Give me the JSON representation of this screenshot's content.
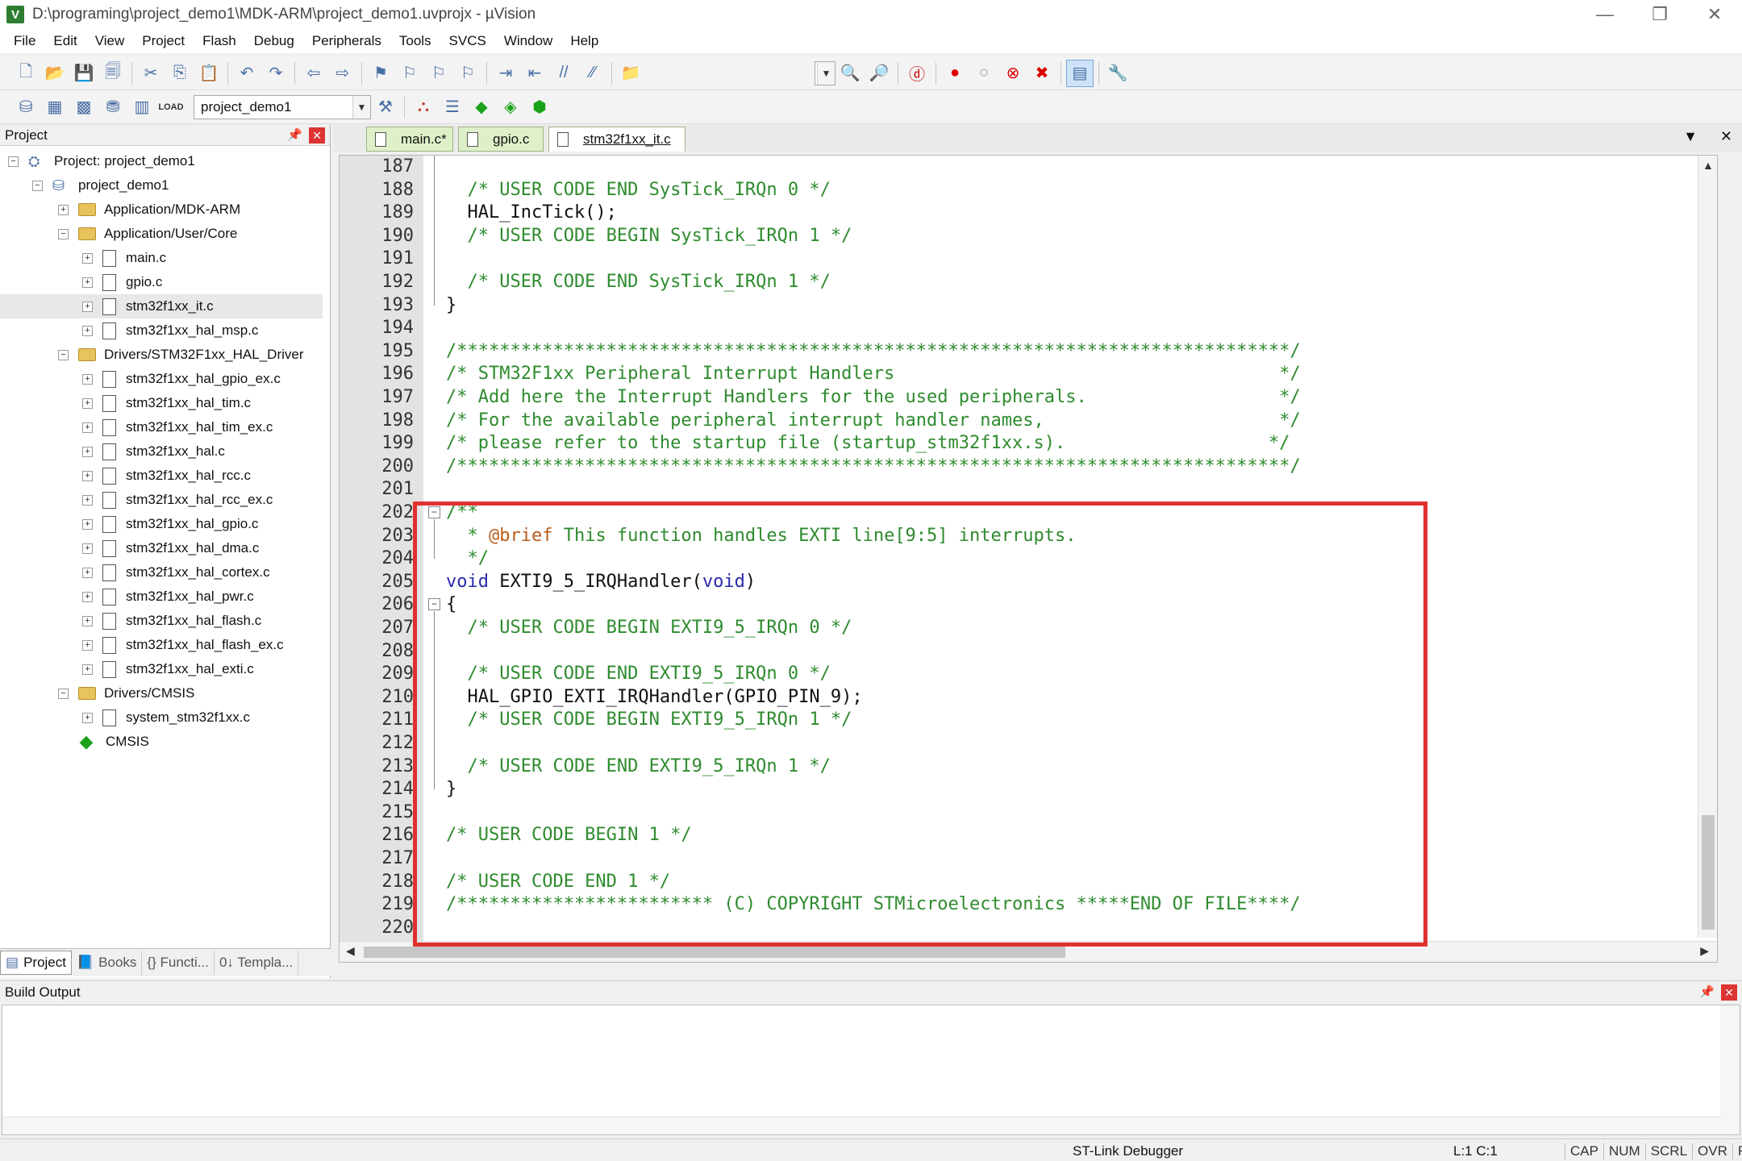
{
  "window": {
    "title": "D:\\programing\\project_demo1\\MDK-ARM\\project_demo1.uvprojx - µVision",
    "app_icon": "V",
    "controls": {
      "minimize": "—",
      "restore": "❐",
      "close": "✕"
    }
  },
  "menu": [
    "File",
    "Edit",
    "View",
    "Project",
    "Flash",
    "Debug",
    "Peripherals",
    "Tools",
    "SVCS",
    "Window",
    "Help"
  ],
  "toolbar": {
    "target_combo": "project_demo1",
    "load_label": "LOAD"
  },
  "project_panel": {
    "title": "Project",
    "tree": [
      {
        "label": "Project: project_demo1",
        "kind": "project",
        "expander": "−",
        "indent": 0
      },
      {
        "label": "project_demo1",
        "kind": "target",
        "expander": "−",
        "indent": 1
      },
      {
        "label": "Application/MDK-ARM",
        "kind": "folder",
        "expander": "+",
        "indent": 2
      },
      {
        "label": "Application/User/Core",
        "kind": "folder",
        "expander": "−",
        "indent": 2
      },
      {
        "label": "main.c",
        "kind": "file",
        "expander": "+",
        "indent": 3
      },
      {
        "label": "gpio.c",
        "kind": "file",
        "expander": "+",
        "indent": 3
      },
      {
        "label": "stm32f1xx_it.c",
        "kind": "file",
        "expander": "+",
        "indent": 3,
        "selected": true
      },
      {
        "label": "stm32f1xx_hal_msp.c",
        "kind": "file",
        "expander": "+",
        "indent": 3
      },
      {
        "label": "Drivers/STM32F1xx_HAL_Driver",
        "kind": "folder",
        "expander": "−",
        "indent": 2
      },
      {
        "label": "stm32f1xx_hal_gpio_ex.c",
        "kind": "file",
        "expander": "+",
        "indent": 3
      },
      {
        "label": "stm32f1xx_hal_tim.c",
        "kind": "file",
        "expander": "+",
        "indent": 3
      },
      {
        "label": "stm32f1xx_hal_tim_ex.c",
        "kind": "file",
        "expander": "+",
        "indent": 3
      },
      {
        "label": "stm32f1xx_hal.c",
        "kind": "file",
        "expander": "+",
        "indent": 3
      },
      {
        "label": "stm32f1xx_hal_rcc.c",
        "kind": "file",
        "expander": "+",
        "indent": 3
      },
      {
        "label": "stm32f1xx_hal_rcc_ex.c",
        "kind": "file",
        "expander": "+",
        "indent": 3
      },
      {
        "label": "stm32f1xx_hal_gpio.c",
        "kind": "file",
        "expander": "+",
        "indent": 3
      },
      {
        "label": "stm32f1xx_hal_dma.c",
        "kind": "file",
        "expander": "+",
        "indent": 3
      },
      {
        "label": "stm32f1xx_hal_cortex.c",
        "kind": "file",
        "expander": "+",
        "indent": 3
      },
      {
        "label": "stm32f1xx_hal_pwr.c",
        "kind": "file",
        "expander": "+",
        "indent": 3
      },
      {
        "label": "stm32f1xx_hal_flash.c",
        "kind": "file",
        "expander": "+",
        "indent": 3
      },
      {
        "label": "stm32f1xx_hal_flash_ex.c",
        "kind": "file",
        "expander": "+",
        "indent": 3
      },
      {
        "label": "stm32f1xx_hal_exti.c",
        "kind": "file",
        "expander": "+",
        "indent": 3
      },
      {
        "label": "Drivers/CMSIS",
        "kind": "folder",
        "expander": "−",
        "indent": 2
      },
      {
        "label": "system_stm32f1xx.c",
        "kind": "file",
        "expander": "+",
        "indent": 3
      },
      {
        "label": "CMSIS",
        "kind": "cmsis",
        "expander": "",
        "indent": 2
      }
    ],
    "tabs": [
      "Project",
      "Books",
      "{} Functi...",
      "0↓ Templa..."
    ]
  },
  "editor": {
    "tabs": [
      {
        "label": "main.c*",
        "active": false
      },
      {
        "label": "gpio.c",
        "active": false
      },
      {
        "label": "stm32f1xx_it.c",
        "active": true
      }
    ],
    "lines": [
      {
        "n": "187",
        "parts": []
      },
      {
        "n": "188",
        "parts": [
          {
            "t": "  /* USER CODE END SysTick_IRQn 0 */",
            "c": "c-comment"
          }
        ]
      },
      {
        "n": "189",
        "parts": [
          {
            "t": "  HAL_IncTick();",
            "c": "c-text"
          }
        ]
      },
      {
        "n": "190",
        "parts": [
          {
            "t": "  /* USER CODE BEGIN SysTick_IRQn 1 */",
            "c": "c-comment"
          }
        ]
      },
      {
        "n": "191",
        "parts": []
      },
      {
        "n": "192",
        "parts": [
          {
            "t": "  /* USER CODE END SysTick_IRQn 1 */",
            "c": "c-comment"
          }
        ]
      },
      {
        "n": "193",
        "parts": [
          {
            "t": "}",
            "c": "c-text"
          }
        ]
      },
      {
        "n": "194",
        "parts": []
      },
      {
        "n": "195",
        "parts": [
          {
            "t": "/******************************************************************************/",
            "c": "c-comment"
          }
        ]
      },
      {
        "n": "196",
        "parts": [
          {
            "t": "/* STM32F1xx Peripheral Interrupt Handlers                                    */",
            "c": "c-comment"
          }
        ]
      },
      {
        "n": "197",
        "parts": [
          {
            "t": "/* Add here the Interrupt Handlers for the used peripherals.                  */",
            "c": "c-comment"
          }
        ]
      },
      {
        "n": "198",
        "parts": [
          {
            "t": "/* For the available peripheral interrupt handler names,                      */",
            "c": "c-comment"
          }
        ]
      },
      {
        "n": "199",
        "parts": [
          {
            "t": "/* please refer to the startup file (startup_stm32f1xx.s).                   */",
            "c": "c-comment"
          }
        ]
      },
      {
        "n": "200",
        "parts": [
          {
            "t": "/******************************************************************************/",
            "c": "c-comment"
          }
        ]
      },
      {
        "n": "201",
        "parts": []
      },
      {
        "n": "202",
        "parts": [
          {
            "t": "/**",
            "c": "c-comment"
          }
        ]
      },
      {
        "n": "203",
        "parts": [
          {
            "t": "  * ",
            "c": "c-comment"
          },
          {
            "t": "@brief",
            "c": "c-doc"
          },
          {
            "t": " This function handles EXTI line[9:5] interrupts.",
            "c": "c-comment"
          }
        ]
      },
      {
        "n": "204",
        "parts": [
          {
            "t": "  */",
            "c": "c-comment"
          }
        ]
      },
      {
        "n": "205",
        "parts": [
          {
            "t": "void",
            "c": "c-kw"
          },
          {
            "t": " EXTI9_5_IRQHandler(",
            "c": "c-text"
          },
          {
            "t": "void",
            "c": "c-kw"
          },
          {
            "t": ")",
            "c": "c-text"
          }
        ]
      },
      {
        "n": "206",
        "parts": [
          {
            "t": "{",
            "c": "c-text"
          }
        ]
      },
      {
        "n": "207",
        "parts": [
          {
            "t": "  /* USER CODE BEGIN EXTI9_5_IRQn 0 */",
            "c": "c-comment"
          }
        ]
      },
      {
        "n": "208",
        "parts": []
      },
      {
        "n": "209",
        "parts": [
          {
            "t": "  /* USER CODE END EXTI9_5_IRQn 0 */",
            "c": "c-comment"
          }
        ]
      },
      {
        "n": "210",
        "parts": [
          {
            "t": "  HAL_GPIO_EXTI_IRQHandler(GPIO_PIN_9);",
            "c": "c-text"
          }
        ]
      },
      {
        "n": "211",
        "parts": [
          {
            "t": "  /* USER CODE BEGIN EXTI9_5_IRQn 1 */",
            "c": "c-comment"
          }
        ]
      },
      {
        "n": "212",
        "parts": []
      },
      {
        "n": "213",
        "parts": [
          {
            "t": "  /* USER CODE END EXTI9_5_IRQn 1 */",
            "c": "c-comment"
          }
        ]
      },
      {
        "n": "214",
        "parts": [
          {
            "t": "}",
            "c": "c-text"
          }
        ]
      },
      {
        "n": "215",
        "parts": []
      },
      {
        "n": "216",
        "parts": [
          {
            "t": "/* USER CODE BEGIN 1 */",
            "c": "c-comment"
          }
        ]
      },
      {
        "n": "217",
        "parts": []
      },
      {
        "n": "218",
        "parts": [
          {
            "t": "/* USER CODE END 1 */",
            "c": "c-comment"
          }
        ]
      },
      {
        "n": "219",
        "parts": [
          {
            "t": "/************************ (C) COPYRIGHT STMicroelectronics *****END OF FILE****/",
            "c": "c-comment"
          }
        ]
      },
      {
        "n": "220",
        "parts": []
      }
    ]
  },
  "build_output": {
    "title": "Build Output"
  },
  "status": {
    "debugger": "ST-Link Debugger",
    "position": "L:1 C:1",
    "flags": [
      "CAP",
      "NUM",
      "SCRL",
      "OVR",
      "R/W"
    ]
  },
  "colors": {
    "highlight_box": "#e03030",
    "comment": "#2e8b2e",
    "keyword": "#2a2aaa",
    "doc_tag": "#b85c1a"
  }
}
